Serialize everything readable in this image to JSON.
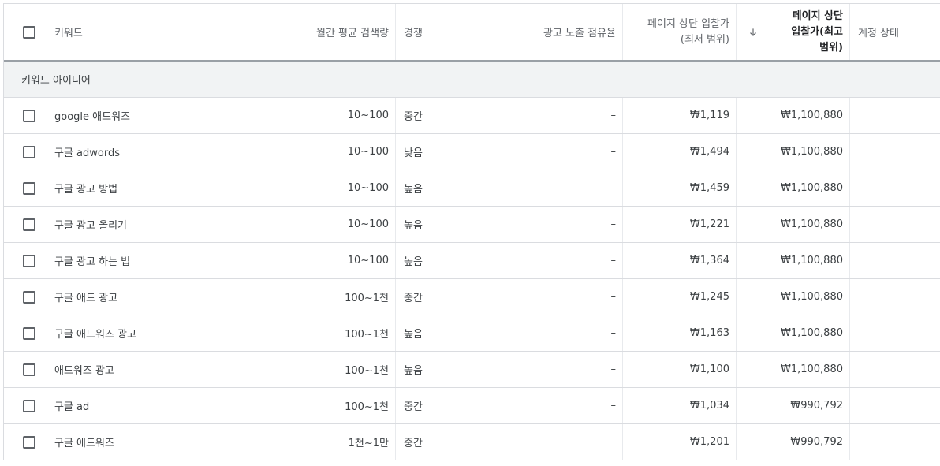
{
  "header": {
    "keyword": "키워드",
    "monthly_volume": "월간 평균 검색량",
    "competition": "경쟁",
    "impression_share": "광고 노출 점유율",
    "top_bid_low": "페이지 상단 입찰가\n(최저 범위)",
    "top_bid_low_line1": "페이지 상단 입찰가",
    "top_bid_low_line2": "(최저 범위)",
    "top_bid_high_line1": "페이지 상단",
    "top_bid_high_line2": "입찰가(최고",
    "top_bid_high_line3": "범위)",
    "account_status": "계정 상태",
    "sort_icon": "arrow-down-icon"
  },
  "group": {
    "label": "키워드 아이디어"
  },
  "rows": [
    {
      "keyword": "google 애드워즈",
      "volume": "10~100",
      "competition": "중간",
      "share": "–",
      "low": "₩1,119",
      "high": "₩1,100,880"
    },
    {
      "keyword": "구글 adwords",
      "volume": "10~100",
      "competition": "낮음",
      "share": "–",
      "low": "₩1,494",
      "high": "₩1,100,880"
    },
    {
      "keyword": "구글 광고 방법",
      "volume": "10~100",
      "competition": "높음",
      "share": "–",
      "low": "₩1,459",
      "high": "₩1,100,880"
    },
    {
      "keyword": "구글 광고 올리기",
      "volume": "10~100",
      "competition": "높음",
      "share": "–",
      "low": "₩1,221",
      "high": "₩1,100,880"
    },
    {
      "keyword": "구글 광고 하는 법",
      "volume": "10~100",
      "competition": "높음",
      "share": "–",
      "low": "₩1,364",
      "high": "₩1,100,880"
    },
    {
      "keyword": "구글 애드 광고",
      "volume": "100~1천",
      "competition": "중간",
      "share": "–",
      "low": "₩1,245",
      "high": "₩1,100,880"
    },
    {
      "keyword": "구글 애드워즈 광고",
      "volume": "100~1천",
      "competition": "높음",
      "share": "–",
      "low": "₩1,163",
      "high": "₩1,100,880"
    },
    {
      "keyword": "애드워즈 광고",
      "volume": "100~1천",
      "competition": "높음",
      "share": "–",
      "low": "₩1,100",
      "high": "₩1,100,880"
    },
    {
      "keyword": "구글 ad",
      "volume": "100~1천",
      "competition": "중간",
      "share": "–",
      "low": "₩1,034",
      "high": "₩990,792"
    },
    {
      "keyword": "구글 애드워즈",
      "volume": "1천~1만",
      "competition": "중간",
      "share": "–",
      "low": "₩1,201",
      "high": "₩990,792"
    }
  ]
}
